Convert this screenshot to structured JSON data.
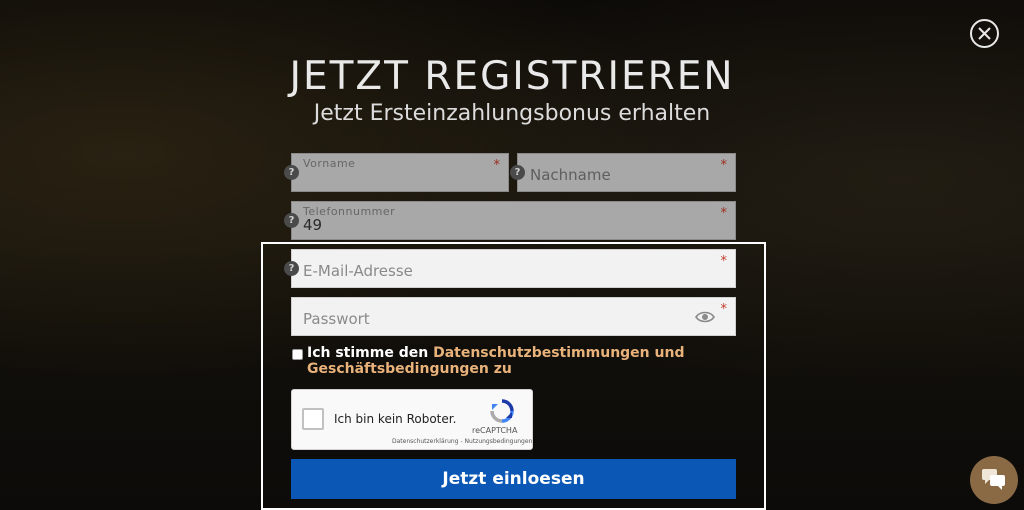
{
  "modal": {
    "title": "JETZT REGISTRIEREN",
    "subtitle": "Jetzt Ersteinzahlungsbonus erhalten"
  },
  "form": {
    "first_name": {
      "label": "Vorname",
      "value": "",
      "required": "*"
    },
    "last_name": {
      "placeholder": "Nachname",
      "required": "*"
    },
    "phone": {
      "label": "Telefonnummer",
      "value": "49",
      "required": "*"
    },
    "email": {
      "placeholder": "E-Mail-Adresse",
      "required": "*"
    },
    "password": {
      "placeholder": "Passwort",
      "required": "*"
    },
    "help_glyph": "?",
    "consent": {
      "prefix": "Ich stimme den ",
      "link_privacy": "Datenschutzbestimmungen",
      "middle": " und ",
      "link_terms": "Geschäftsbedingungen",
      "suffix": " zu"
    },
    "captcha": {
      "label": "Ich bin kein Roboter.",
      "brand": "reCAPTCHA",
      "privacy": "Datenschutzerklärung",
      "separator": " - ",
      "terms": "Nutzungsbedingungen"
    },
    "submit_label": "Jetzt einloesen"
  },
  "icons": {
    "close": "close-icon",
    "help": "help-icon",
    "eye": "eye-icon",
    "recaptcha": "recaptcha-logo-icon",
    "chat": "chat-icon"
  },
  "colors": {
    "accent_link": "#e8b27a",
    "submit_bg": "#0b57b5",
    "required_star": "#c0392b",
    "chat_bg": "#8a6a45"
  }
}
